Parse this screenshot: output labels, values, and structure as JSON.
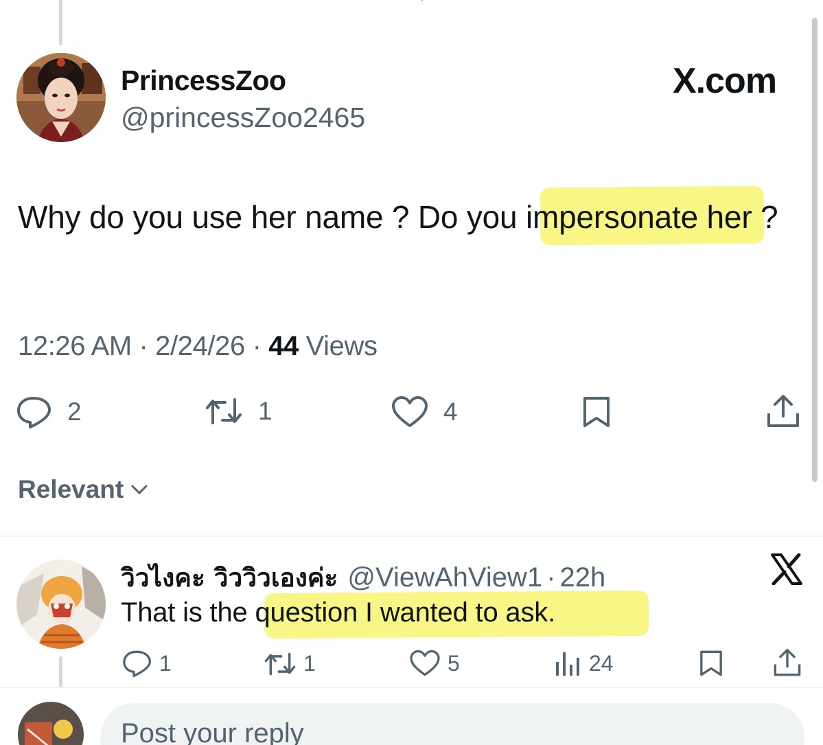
{
  "tweet": {
    "author": {
      "display_name": "PrincessZoo",
      "handle": "@princessZoo2465"
    },
    "watermark": "X.com",
    "text_part1": "Why do you use her name ? Do you ",
    "text_highlight": "impersonate",
    "text_part2": " her ?",
    "time": "12:26 AM",
    "date": "2/24/26",
    "views_count": "44",
    "views_label": "Views",
    "separator": "·",
    "counts": {
      "replies": "2",
      "reposts": "1",
      "likes": "4"
    }
  },
  "sort": {
    "label": "Relevant"
  },
  "reply": {
    "display_name": "วิวไงคะ วิววิวเองค่ะ",
    "handle": "@ViewAhView1",
    "separator": "·",
    "time_ago": "22h",
    "text_part1": "That is the ",
    "text_highlight": "question I wanted to ask.",
    "counts": {
      "replies": "1",
      "reposts": "1",
      "likes": "5",
      "views": "24"
    }
  },
  "composer": {
    "placeholder": "Post your reply"
  },
  "colors": {
    "text": "#0f1419",
    "muted": "#536471",
    "highlight": "#f8f77f",
    "divider": "#eff3f4"
  },
  "icons": [
    "reply-icon",
    "repost-icon",
    "like-icon",
    "bookmark-icon",
    "share-icon",
    "views-icon",
    "chevron-down-icon",
    "x-logo-icon"
  ]
}
